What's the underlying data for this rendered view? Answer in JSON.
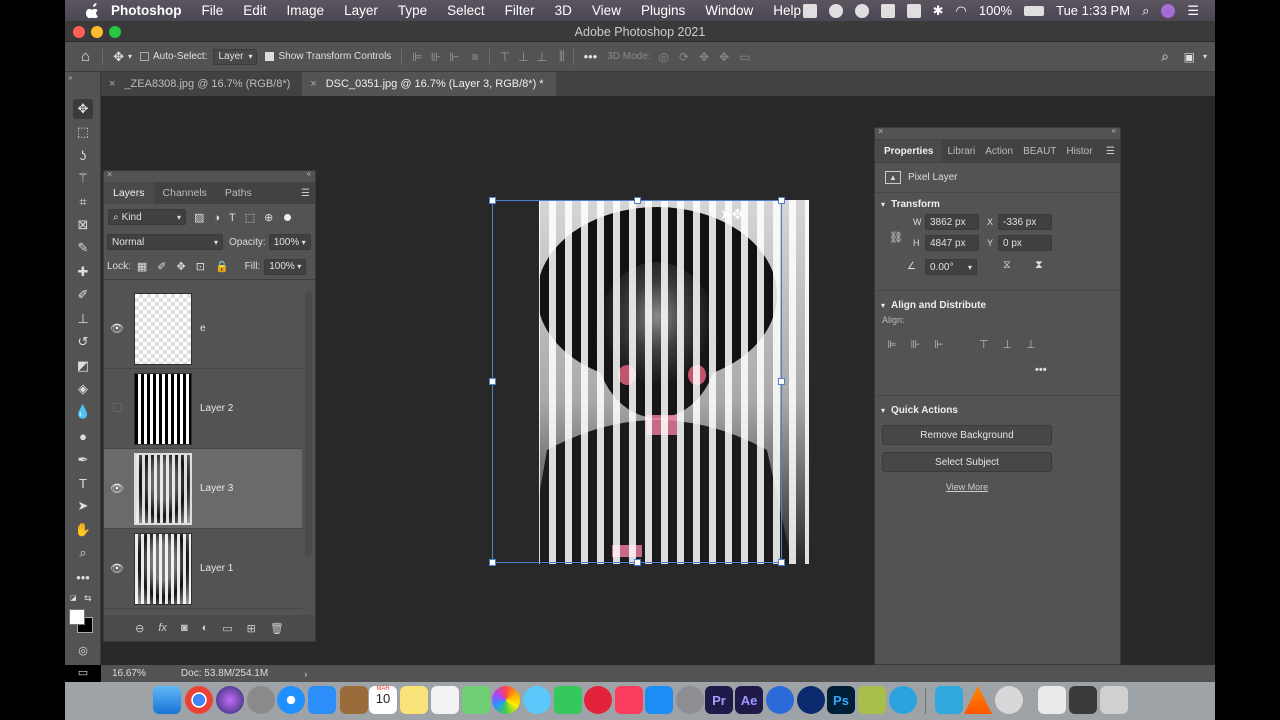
{
  "menubar": {
    "app_name": "Photoshop",
    "items": [
      "File",
      "Edit",
      "Image",
      "Layer",
      "Type",
      "Select",
      "Filter",
      "3D",
      "View",
      "Plugins",
      "Window",
      "Help"
    ],
    "battery": "100%",
    "clock": "Tue 1:33 PM"
  },
  "window": {
    "title": "Adobe Photoshop 2021"
  },
  "options_bar": {
    "auto_select_label": "Auto-Select:",
    "auto_select_target": "Layer",
    "show_transform_label": "Show Transform Controls",
    "mode_3d_label": "3D Mode:"
  },
  "tabs": [
    {
      "label": "_ZEA8308.jpg @ 16.7% (RGB/8*)"
    },
    {
      "label": "DSC_0351.jpg @ 16.7% (Layer 3, RGB/8*) *"
    }
  ],
  "layers_panel": {
    "tabs": [
      "Layers",
      "Channels",
      "Paths"
    ],
    "filter_kind": "Kind",
    "blend_mode": "Normal",
    "opacity_label": "Opacity:",
    "opacity_value": "100%",
    "lock_label": "Lock:",
    "fill_label": "Fill:",
    "fill_value": "100%",
    "layers": [
      {
        "name": "e",
        "visible": true,
        "selected": false
      },
      {
        "name": "Layer 2",
        "visible": false,
        "selected": false
      },
      {
        "name": "Layer 3",
        "visible": true,
        "selected": true
      },
      {
        "name": "Layer 1",
        "visible": true,
        "selected": false
      }
    ]
  },
  "properties_panel": {
    "tabs": [
      "Properties",
      "Librari",
      "Action",
      "BEAUT",
      "Histor"
    ],
    "layer_type": "Pixel Layer",
    "transform": {
      "title": "Transform",
      "w_label": "W",
      "w_value": "3862 px",
      "x_label": "X",
      "x_value": "-336 px",
      "h_label": "H",
      "h_value": "4847 px",
      "y_label": "Y",
      "y_value": "0 px",
      "angle_value": "0.00°"
    },
    "align": {
      "title": "Align and Distribute",
      "align_label": "Align:"
    },
    "quick_actions": {
      "title": "Quick Actions",
      "remove_bg": "Remove Background",
      "select_subject": "Select Subject",
      "view_more": "View More"
    }
  },
  "statusbar": {
    "zoom": "16.67%",
    "doc": "Doc: 53.8M/254.1M"
  },
  "dock": {
    "calendar_day": "10",
    "calendar_month": "MAR",
    "ps_label": "Ps",
    "pr_label": "Pr",
    "ae_label": "Ae"
  }
}
